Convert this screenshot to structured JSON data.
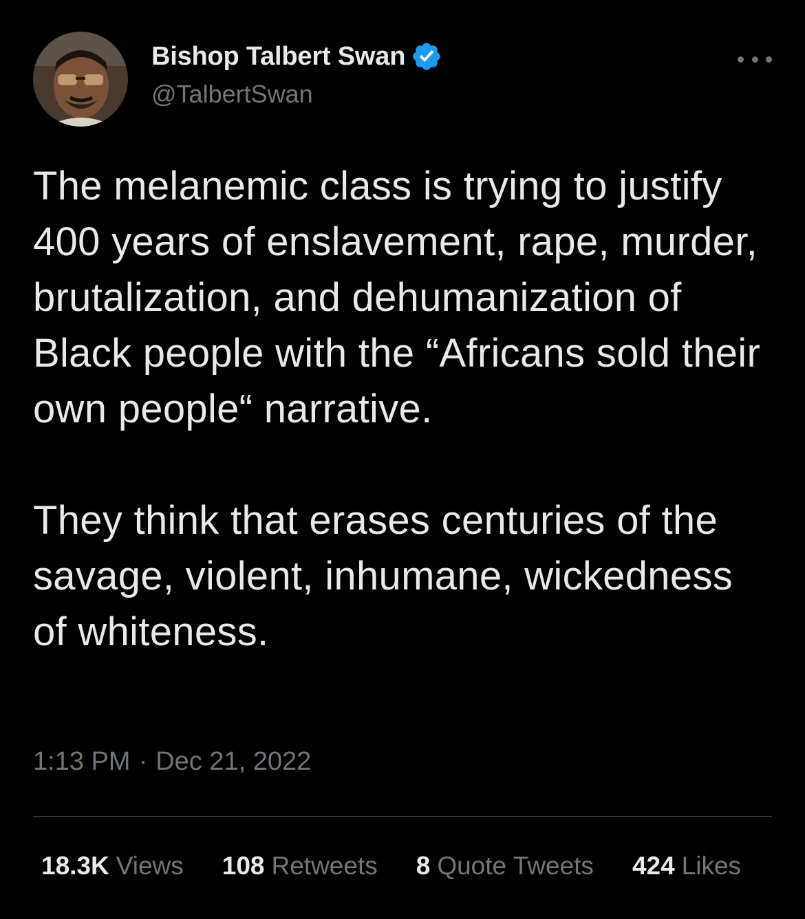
{
  "author": {
    "display_name": "Bishop Talbert Swan",
    "handle": "@TalbertSwan",
    "verified": true,
    "verified_color": "#1d9bf0"
  },
  "tweet": {
    "paragraphs": [
      "The melanemic class is trying to justify 400 years of enslavement, rape, murder, brutalization, and dehumanization of Black people with the “Africans sold their own people“ narrative.",
      "They think that erases centuries of the savage, violent, inhumane, wickedness of whiteness."
    ],
    "time": "1:13 PM",
    "separator": "·",
    "date": "Dec 21, 2022"
  },
  "stats": {
    "views": {
      "value": "18.3K",
      "label": "Views"
    },
    "retweets": {
      "value": "108",
      "label": "Retweets"
    },
    "quotes": {
      "value": "8",
      "label": "Quote Tweets"
    },
    "likes": {
      "value": "424",
      "label": "Likes"
    }
  },
  "icons": {
    "avatar": "profile-photo",
    "badge": "verified-badge-icon",
    "more": "more-options-icon"
  },
  "colors": {
    "background": "#000000",
    "primary_text": "#e7e9ea",
    "secondary_text": "#71767b",
    "divider": "#2f3336"
  }
}
